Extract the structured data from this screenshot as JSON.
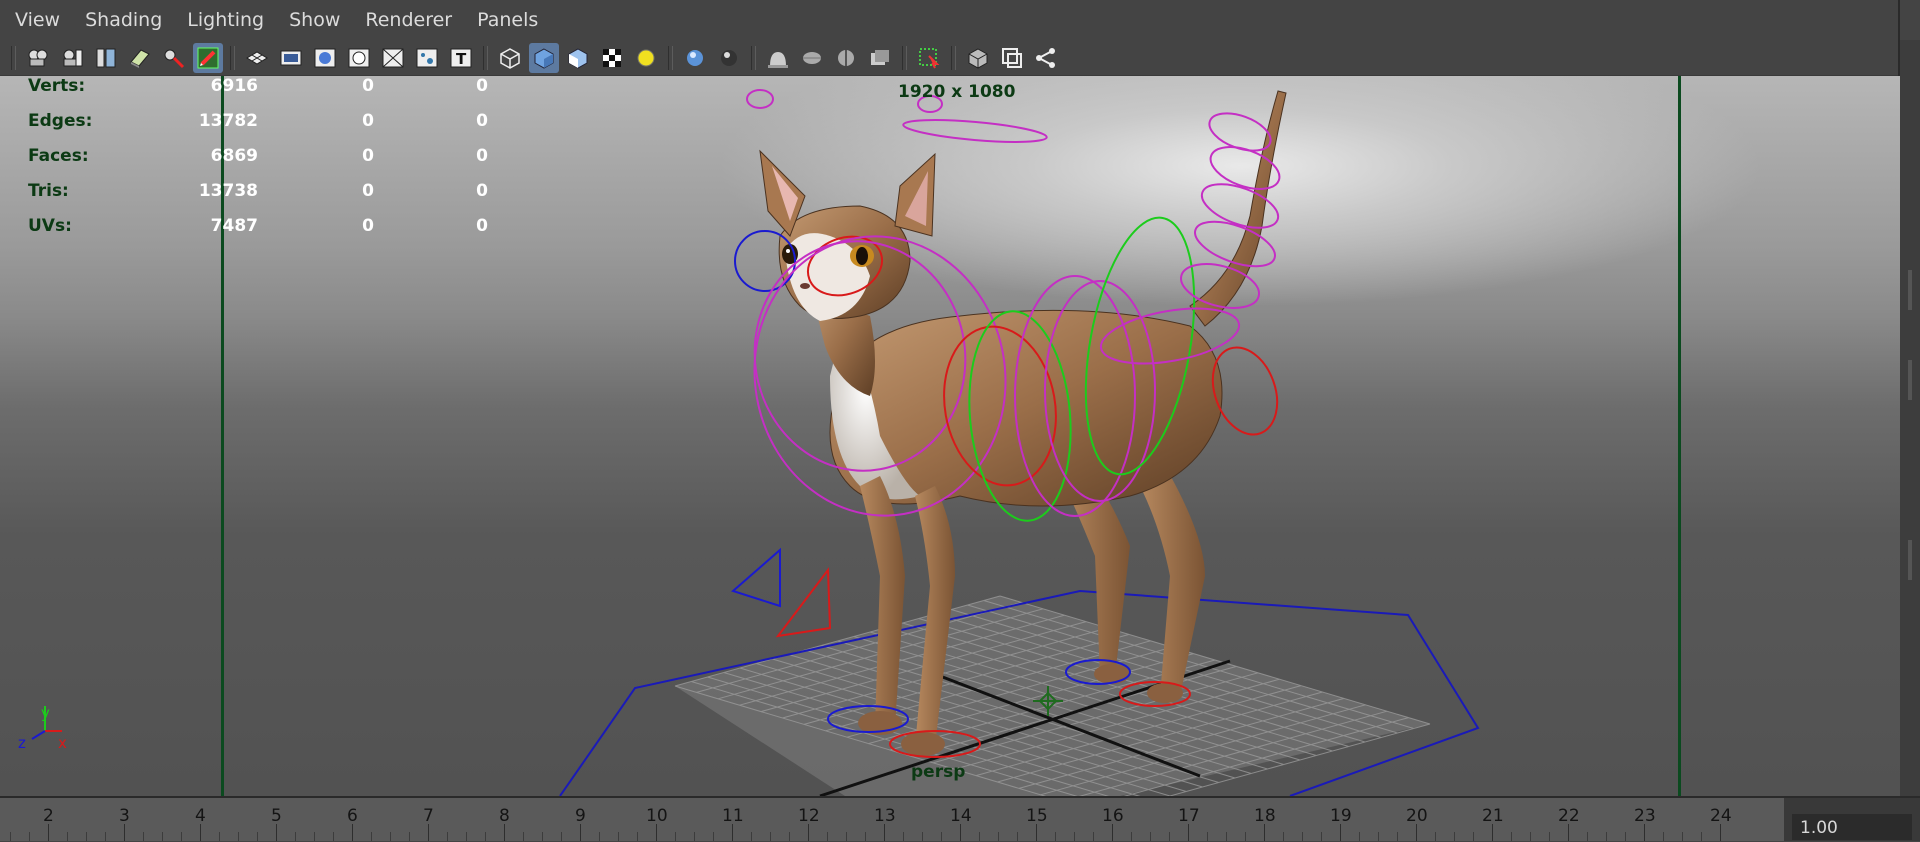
{
  "menubar": {
    "items": [
      "View",
      "Shading",
      "Lighting",
      "Show",
      "Renderer",
      "Panels"
    ]
  },
  "toolbar": {
    "icons": [
      "select-camera-icon",
      "camera-attributes-icon",
      "bookmarks-icon",
      "image-plane-icon",
      "two-d-pan-zoom-icon",
      "grease-pencil-icon",
      "grid-icon",
      "film-gate-icon",
      "resolution-gate-icon",
      "gate-mask-icon",
      "field-chart-icon",
      "safe-action-icon",
      "wireframe-icon",
      "smooth-shade-icon",
      "default-material-icon",
      "textured-icon",
      "use-all-lights-icon",
      "shadows-icon",
      "screen-space-ao-icon",
      "motion-blur-icon",
      "multisample-aa-icon",
      "depth-of-field-icon",
      "hardware-fog-icon",
      "isolate-select-icon",
      "xray-icon",
      "xray-active-icon",
      "xray-joints-icon"
    ]
  },
  "hud": {
    "rows": [
      {
        "label": "Verts:",
        "v1": "6916",
        "v2": "0",
        "v3": "0"
      },
      {
        "label": "Edges:",
        "v1": "13782",
        "v2": "0",
        "v3": "0"
      },
      {
        "label": "Faces:",
        "v1": "6869",
        "v2": "0",
        "v3": "0"
      },
      {
        "label": "Tris:",
        "v1": "13738",
        "v2": "0",
        "v3": "0"
      },
      {
        "label": "UVs:",
        "v1": "7487",
        "v2": "0",
        "v3": "0"
      }
    ],
    "resolution": "1920 x 1080",
    "camera": "persp"
  },
  "axis_gizmo": {
    "x": "x",
    "y": "y",
    "z": "z"
  },
  "timeslider": {
    "frames": [
      "2",
      "3",
      "4",
      "5",
      "6",
      "7",
      "8",
      "9",
      "10",
      "11",
      "12",
      "13",
      "14",
      "15",
      "16",
      "17",
      "18",
      "19",
      "20",
      "21",
      "22",
      "23",
      "24"
    ],
    "current_frame_field": "1.00"
  },
  "colors": {
    "hud_label": "#0c3a14",
    "gate_line": "#0b4a1f",
    "control_magenta": "#c42fc4",
    "control_red": "#d81a1a",
    "control_green": "#1ccc1c",
    "control_blue": "#1a1ad0"
  }
}
